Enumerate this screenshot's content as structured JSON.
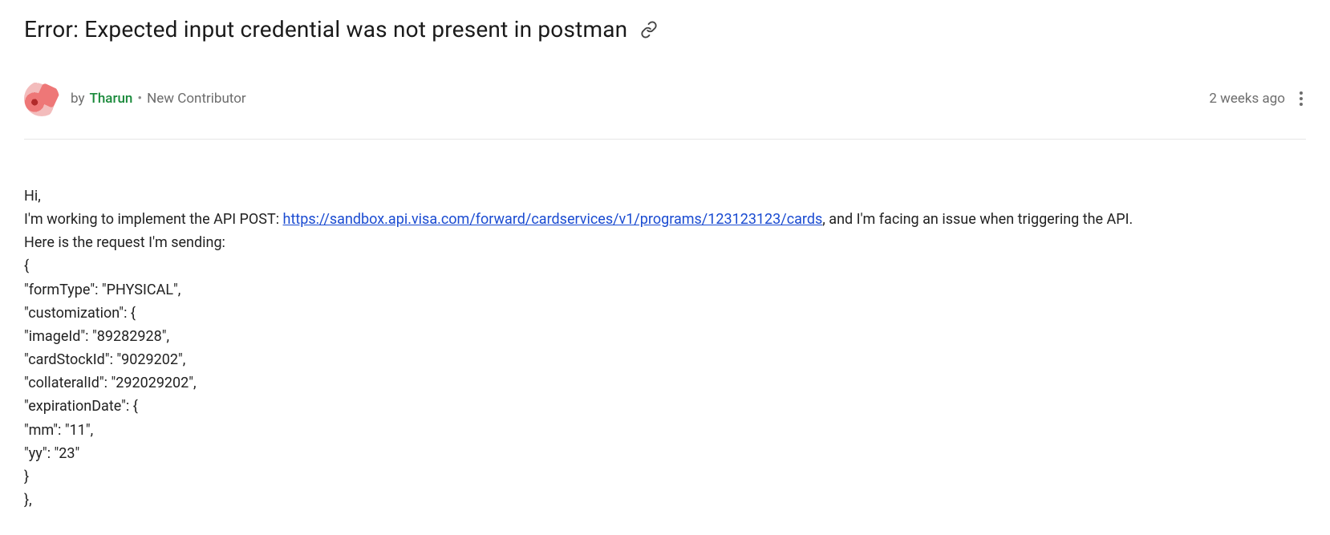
{
  "post": {
    "title": "Error: Expected input credential was not present in postman",
    "by_label": "by",
    "author": "Tharun",
    "badge": "New Contributor",
    "timestamp": "2 weeks ago"
  },
  "body": {
    "line1": "Hi,",
    "line2_pre": "I'm working to implement the API POST: ",
    "api_url": "https://sandbox.api.visa.com/forward/cardservices/v1/programs/123123123/cards",
    "line2_post": ", and I'm facing an issue when triggering the API.",
    "line3": "Here is the request I'm sending:",
    "c1": "{",
    "c2": "\"formType\": \"PHYSICAL\",",
    "c3": "\"customization\": {",
    "c4": "\"imageId\": \"89282928\",",
    "c5": "\"cardStockId\": \"9029202\",",
    "c6": "\"collateralId\": \"292029202\",",
    "c7": "\"expirationDate\": {",
    "c8": "\"mm\": \"11\",",
    "c9": "\"yy\": \"23\"",
    "c10": "}",
    "c11": "},"
  }
}
